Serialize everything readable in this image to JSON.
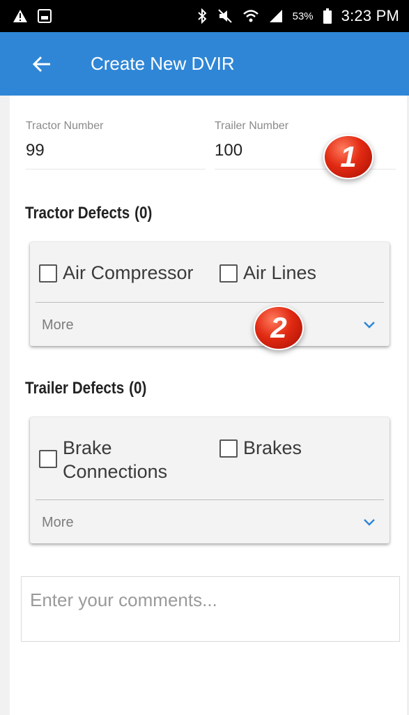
{
  "status_bar": {
    "battery_percent": "53%",
    "time": "3:23 PM",
    "icons": [
      "alert-icon",
      "image-icon",
      "bluetooth-icon",
      "mute-icon",
      "wifi-icon",
      "signal-icon",
      "battery-icon"
    ]
  },
  "app_bar": {
    "title": "Create New DVIR",
    "back_icon": "arrow-left-icon",
    "color": "#2f86d6"
  },
  "tractor_field": {
    "label": "Tractor Number",
    "value": "99"
  },
  "trailer_field": {
    "label": "Trailer Number",
    "value": "100"
  },
  "tractor_defects": {
    "title": "Tractor Defects",
    "count": "(0)",
    "items": [
      {
        "label": "Air Compressor",
        "checked": false
      },
      {
        "label": "Air Lines",
        "checked": false
      }
    ],
    "more_label": "More"
  },
  "trailer_defects": {
    "title": "Trailer Defects",
    "count": "(0)",
    "items": [
      {
        "label_line1": "Brake",
        "label_line2": "Connections",
        "checked": false
      },
      {
        "label": "Brakes",
        "checked": false
      }
    ],
    "more_label": "More"
  },
  "comments": {
    "placeholder": "Enter your comments...",
    "value": ""
  },
  "callouts": [
    "1",
    "2"
  ],
  "colors": {
    "accent": "#2f86d6",
    "chevron": "#2f86d6",
    "callout": "#e12a12"
  }
}
